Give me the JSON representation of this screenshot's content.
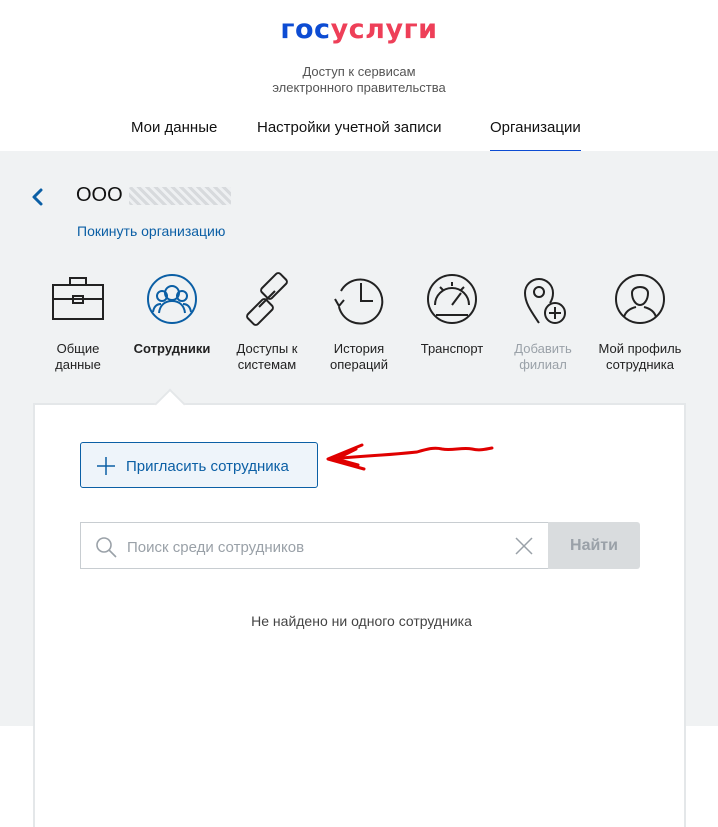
{
  "brand": {
    "part1": "гос",
    "part2": "услуги",
    "color1": "#0d4cd3",
    "color2": "#ee3f58"
  },
  "tagline": {
    "line1": "Доступ к сервисам",
    "line2": "электронного правительства"
  },
  "nav": [
    {
      "label": "Мои данные",
      "active": false
    },
    {
      "label": "Настройки учетной записи",
      "active": false
    },
    {
      "label": "Организации",
      "active": true
    }
  ],
  "org": {
    "name": "ООО",
    "leave_label": "Покинуть организацию"
  },
  "tiles": [
    {
      "label1": "Общие",
      "label2": "данные",
      "icon": "briefcase-icon"
    },
    {
      "label1": "Сотрудники",
      "label2": "",
      "icon": "employees-icon",
      "active": true
    },
    {
      "label1": "Доступы к",
      "label2": "системам",
      "icon": "chain-link-icon"
    },
    {
      "label1": "История",
      "label2": "операций",
      "icon": "history-clock-icon"
    },
    {
      "label1": "Транспорт",
      "label2": "",
      "icon": "speedometer-icon"
    },
    {
      "label1": "Добавить",
      "label2": "филиал",
      "icon": "add-location-icon",
      "disabled": true
    },
    {
      "label1": "Мой профиль",
      "label2": "сотрудника",
      "icon": "profile-icon"
    }
  ],
  "employees": {
    "invite_label": "Пригласить сотрудника",
    "search_placeholder": "Поиск среди сотрудников",
    "search_value": "",
    "find_label": "Найти",
    "empty_message": "Не найдено ни одного сотрудника"
  },
  "colors": {
    "accent": "#0b5fa5",
    "annotation_arrow": "#e00000"
  }
}
